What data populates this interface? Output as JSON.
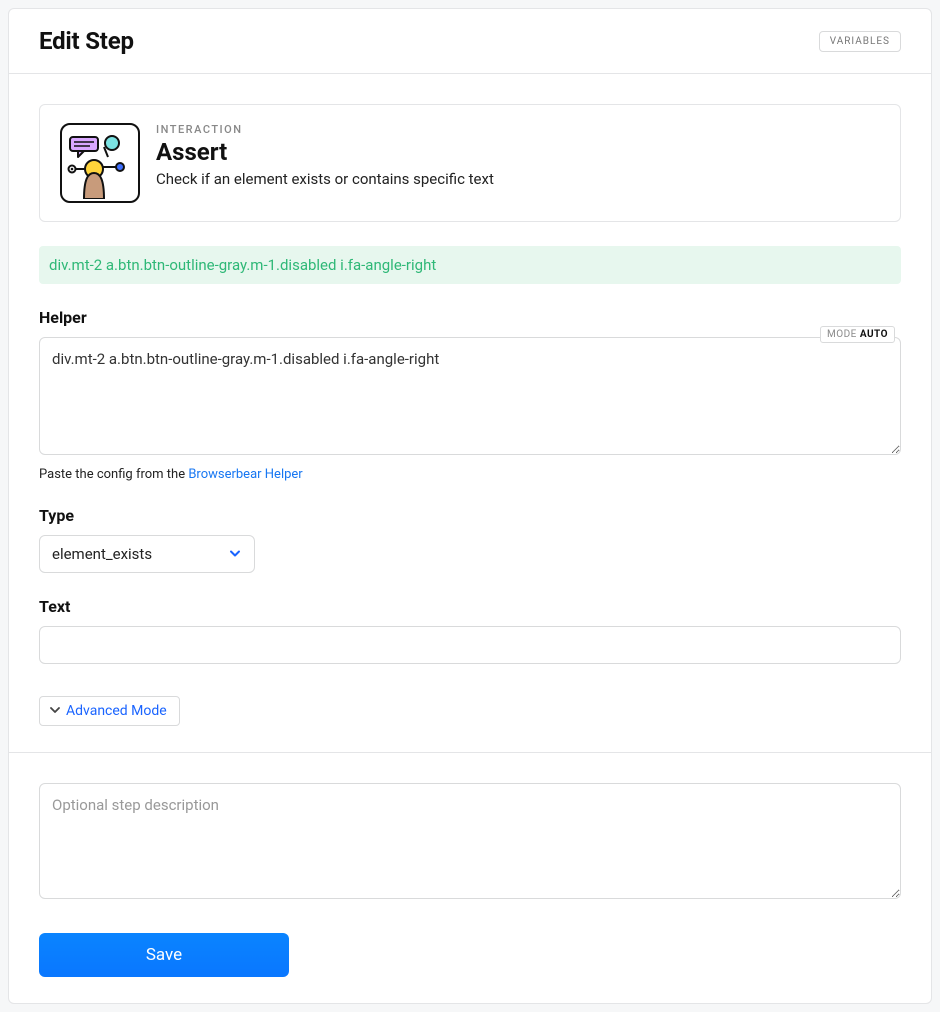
{
  "header": {
    "title": "Edit Step",
    "variables_label": "VARIABLES"
  },
  "interaction": {
    "eyebrow": "INTERACTION",
    "title": "Assert",
    "description": "Check if an element exists or contains specific text"
  },
  "selector_preview": "div.mt-2 a.btn.btn-outline-gray.m-1.disabled i.fa-angle-right",
  "helper": {
    "label": "Helper",
    "mode_prefix": "MODE ",
    "mode_value": "AUTO",
    "value": "div.mt-2 a.btn.btn-outline-gray.m-1.disabled i.fa-angle-right",
    "hint_prefix": "Paste the config from the ",
    "hint_link": "Browserbear Helper"
  },
  "type": {
    "label": "Type",
    "selected": "element_exists"
  },
  "text": {
    "label": "Text",
    "value": ""
  },
  "advanced_label": "Advanced Mode",
  "description_placeholder": "Optional step description",
  "save_label": "Save"
}
